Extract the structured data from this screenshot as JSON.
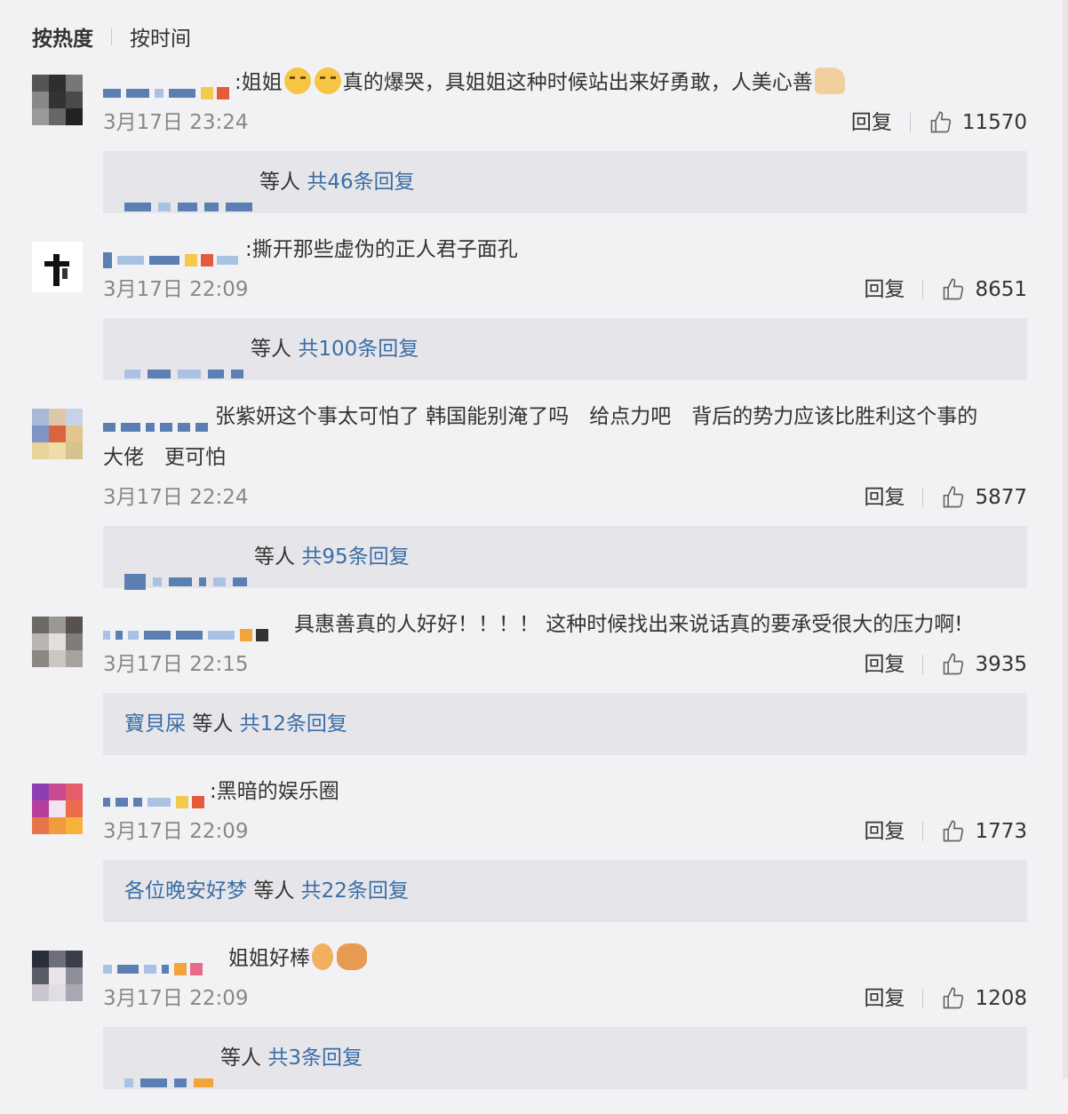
{
  "sort_tabs": {
    "hot": "按热度",
    "time": "按时间"
  },
  "reply_label": "回复",
  "comments": [
    {
      "text_after_emoji": "真的爆哭，具姐姐这种时候站出来好勇敢，人美心善",
      "text_before_emoji": "姐姐",
      "colon": ":",
      "time": "3月17日 23:24",
      "likes": "11570",
      "replies_others": "等人",
      "replies_count": "共46条回复"
    },
    {
      "colon": ":",
      "text": "撕开那些虚伪的正人君子面孔",
      "time": "3月17日 22:09",
      "likes": "8651",
      "replies_others": "等人",
      "replies_count": "共100条回复"
    },
    {
      "text_line1": "张紫妍这个事太可怕了 韩国能别淹了吗　给点力吧　背后的势力应该比胜利这个事的",
      "text_line2": "大佬　更可怕",
      "time": "3月17日 22:24",
      "likes": "5877",
      "replies_others": "等人",
      "replies_count": "共95条回复"
    },
    {
      "text": "具惠善真的人好好！！！！ 这种时候找出来说话真的要承受很大的压力啊!",
      "time": "3月17日 22:15",
      "likes": "3935",
      "replies_user": "寶貝屎",
      "replies_others": "等人",
      "replies_count": "共12条回复"
    },
    {
      "colon": ":",
      "text": "黑暗的娱乐圈",
      "time": "3月17日 22:09",
      "likes": "1773",
      "replies_user": "各位晚安好梦",
      "replies_others": "等人",
      "replies_count": "共22条回复"
    },
    {
      "text": "姐姐好棒",
      "time": "3月17日 22:09",
      "likes": "1208",
      "replies_others": "等人",
      "replies_count": "共3条回复"
    }
  ],
  "colors": {
    "link": "#3a6ea5",
    "background": "#f2f2f5",
    "reply_box": "#e6e6ea",
    "muted": "#888888"
  },
  "icons": {
    "like": "thumbs-up-outline-icon"
  }
}
